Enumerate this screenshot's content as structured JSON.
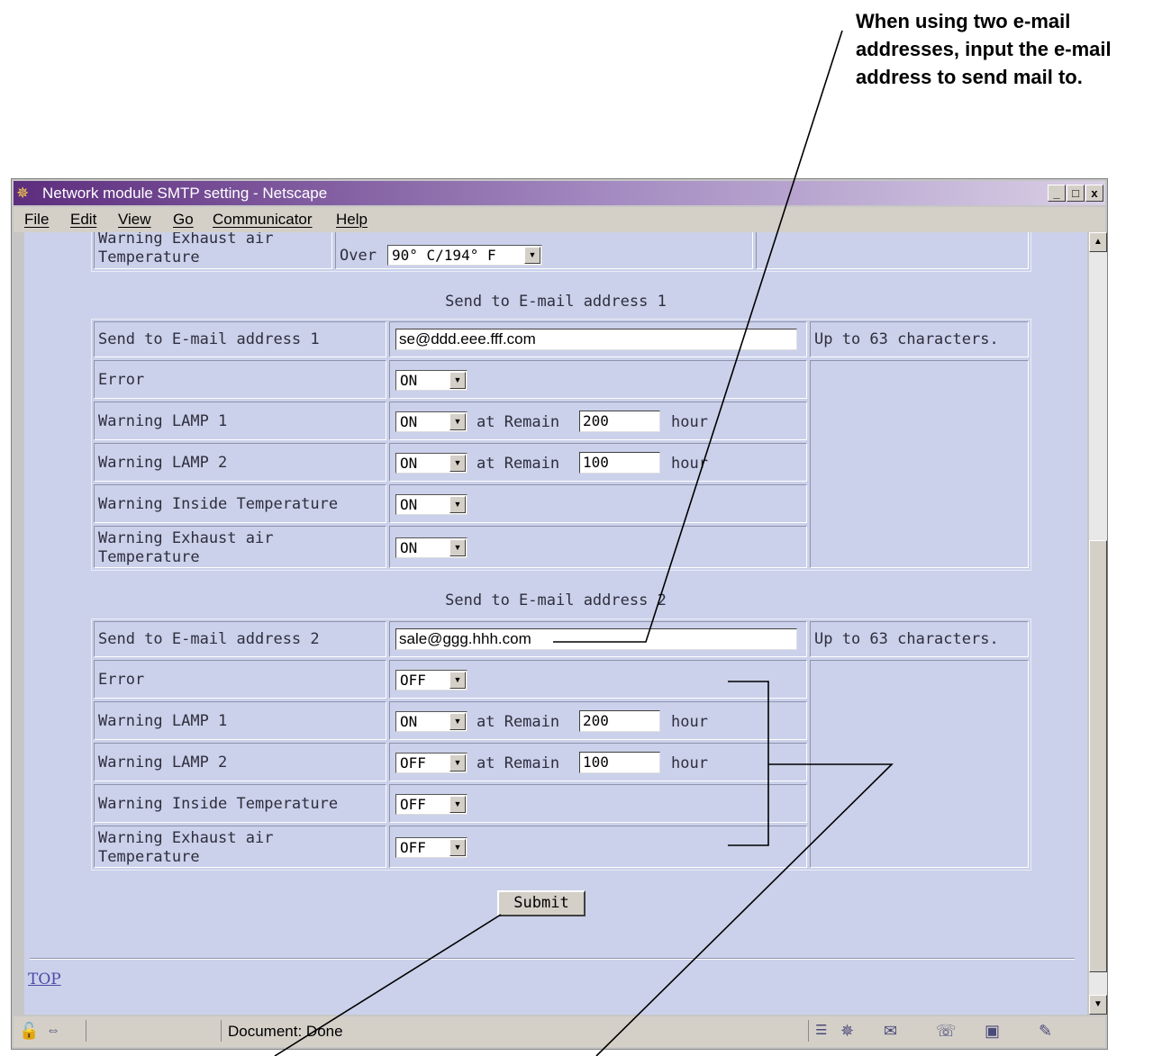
{
  "annotation": {
    "text": "When using two e-mail addresses, input the e-mail address to send mail to."
  },
  "window": {
    "title": "Network module SMTP setting - Netscape",
    "controls": {
      "minimize": "_",
      "maximize": "□",
      "close": "x"
    }
  },
  "menu": [
    "File",
    "Edit",
    "View",
    "Go",
    "Communicator",
    "Help"
  ],
  "top_fragment": {
    "label": "Warning Exhaust air\nTemperature",
    "over_label": "Over",
    "select_value": "90° C/194° F"
  },
  "section1": {
    "heading": "Send to E-mail address 1",
    "email_label": "Send to E-mail address 1",
    "email_value": "se@ddd.eee.fff.com",
    "note": "Up to 63 characters.",
    "rows": [
      {
        "label": "Error",
        "value": "ON"
      },
      {
        "label": "Warning LAMP 1",
        "value": "ON",
        "at": "at Remain",
        "remain": "200",
        "unit": "hour"
      },
      {
        "label": "Warning LAMP 2",
        "value": "ON",
        "at": "at Remain",
        "remain": "100",
        "unit": "hour"
      },
      {
        "label": "Warning Inside Temperature",
        "value": "ON"
      },
      {
        "label": "Warning Exhaust air\nTemperature",
        "value": "ON"
      }
    ]
  },
  "section2": {
    "heading": "Send to E-mail address 2",
    "email_label": "Send to E-mail address 2",
    "email_value": "sale@ggg.hhh.com",
    "note": "Up to 63 characters.",
    "rows": [
      {
        "label": "Error",
        "value": "OFF"
      },
      {
        "label": "Warning LAMP 1",
        "value": "ON",
        "at": "at Remain",
        "remain": "200",
        "unit": "hour"
      },
      {
        "label": "Warning LAMP 2",
        "value": "OFF",
        "at": "at Remain",
        "remain": "100",
        "unit": "hour"
      },
      {
        "label": "Warning Inside Temperature",
        "value": "OFF"
      },
      {
        "label": "Warning Exhaust air\nTemperature",
        "value": "OFF"
      }
    ]
  },
  "submit_label": "Submit",
  "top_link": "TOP",
  "status": {
    "text": "Document: Done"
  },
  "colors": {
    "page_bg": "#cbd1ea",
    "title_gradient_start": "#5d2d7e",
    "link": "#4a4aa8"
  }
}
